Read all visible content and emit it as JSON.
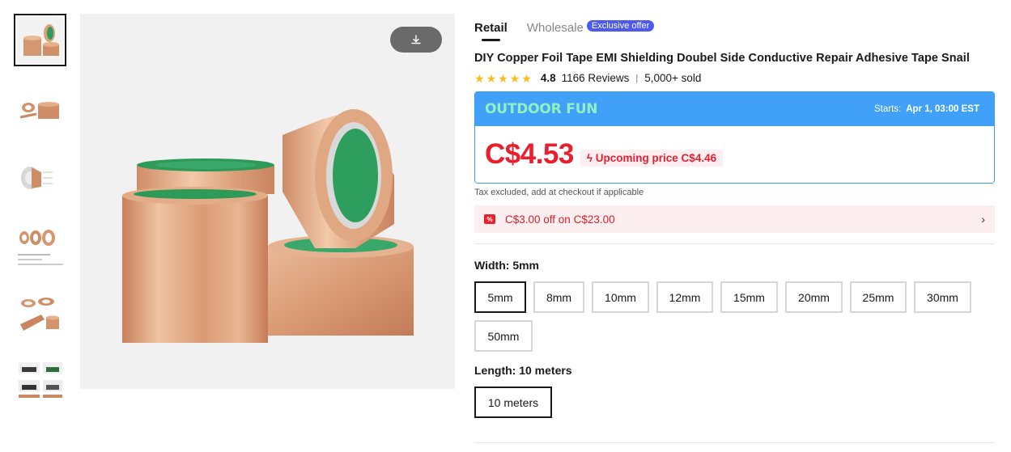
{
  "tabs": {
    "retail": "Retail",
    "wholesale": "Wholesale",
    "exclusive_badge": "Exclusive offer"
  },
  "product": {
    "title": "DIY Copper Foil Tape EMI Shielding Doubel Side Conductive Repair Adhesive Tape Snail",
    "rating": "4.8",
    "reviews": "1166 Reviews",
    "separator": "|",
    "sold": "5,000+ sold",
    "stars": 5
  },
  "promo": {
    "brand": "OUTDOOR FUN",
    "starts_label": "Starts:",
    "starts_value": "Apr 1, 03:00 EST",
    "price": "C$4.53",
    "upcoming": "Upcoming price C$4.46"
  },
  "tax_note": "Tax excluded, add at checkout if applicable",
  "coupon": {
    "icon_text": "%",
    "text": "C$3.00 off on C$23.00",
    "arrow": "›"
  },
  "width": {
    "label": "Width:",
    "selected": "5mm",
    "options": [
      "5mm",
      "8mm",
      "10mm",
      "12mm",
      "15mm",
      "20mm",
      "25mm",
      "30mm",
      "50mm"
    ]
  },
  "length": {
    "label": "Length:",
    "selected": "10 meters",
    "options": [
      "10 meters"
    ]
  },
  "colors": {
    "accent_blue": "#41a1f8",
    "price_red": "#e8202e",
    "brand_green": "#8ff1c0",
    "badge_purple": "#4d5af0",
    "star_yellow": "#f7bd1c"
  }
}
